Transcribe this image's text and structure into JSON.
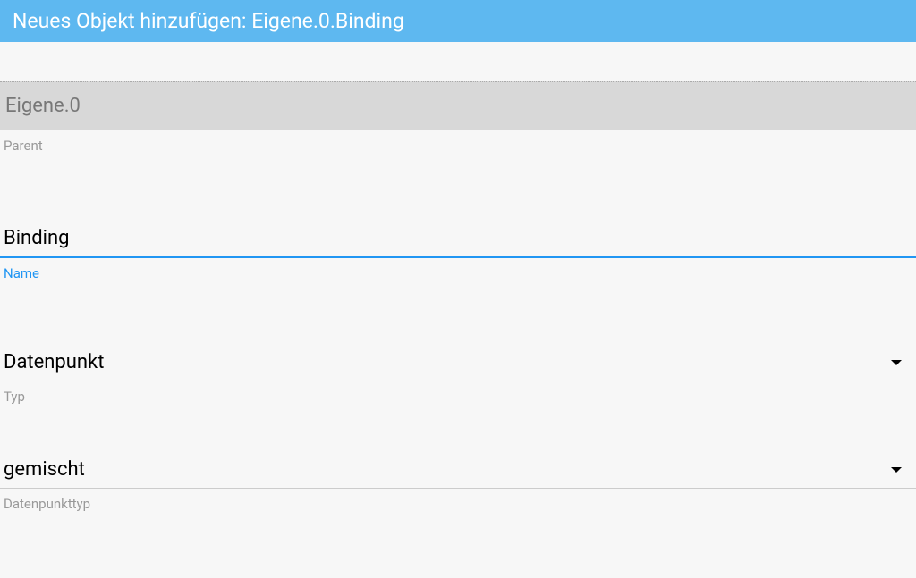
{
  "header": {
    "title": "Neues Objekt hinzufügen: Eigene.0.Binding"
  },
  "form": {
    "parent": {
      "value": "Eigene.0",
      "label": "Parent"
    },
    "name": {
      "value": "Binding",
      "label": "Name"
    },
    "typ": {
      "value": "Datenpunkt",
      "label": "Typ"
    },
    "datentyp": {
      "value": "gemischt",
      "label": "Datenpunkttyp"
    }
  }
}
